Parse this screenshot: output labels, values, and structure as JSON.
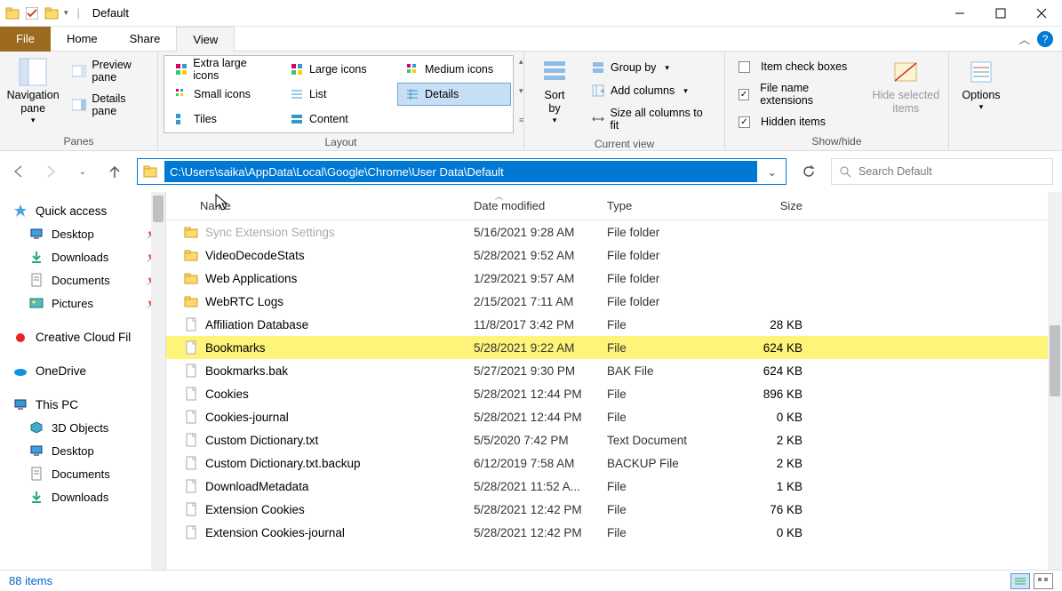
{
  "window": {
    "title": "Default"
  },
  "tabs": {
    "file": "File",
    "home": "Home",
    "share": "Share",
    "view": "View"
  },
  "ribbon": {
    "panes": {
      "label": "Panes",
      "navigation": "Navigation\npane",
      "preview": "Preview pane",
      "details": "Details pane"
    },
    "layout": {
      "label": "Layout",
      "xl_icons": "Extra large icons",
      "lg_icons": "Large icons",
      "md_icons": "Medium icons",
      "sm_icons": "Small icons",
      "list": "List",
      "details": "Details",
      "tiles": "Tiles",
      "content": "Content"
    },
    "currentview": {
      "label": "Current view",
      "sort": "Sort\nby",
      "group": "Group by",
      "addcols": "Add columns",
      "sizecols": "Size all columns to fit"
    },
    "showhide": {
      "label": "Show/hide",
      "itemcheck": "Item check boxes",
      "ext": "File name extensions",
      "hidden": "Hidden items",
      "hidesel": "Hide selected\nitems"
    },
    "options": {
      "label": "Options"
    }
  },
  "address": {
    "path": "C:\\Users\\saika\\AppData\\Local\\Google\\Chrome\\User Data\\Default"
  },
  "search": {
    "placeholder": "Search Default"
  },
  "sidebar": {
    "quick": "Quick access",
    "items": [
      {
        "label": "Desktop",
        "icon": "desktop"
      },
      {
        "label": "Downloads",
        "icon": "download"
      },
      {
        "label": "Documents",
        "icon": "document"
      },
      {
        "label": "Pictures",
        "icon": "picture"
      }
    ],
    "cc": "Creative Cloud Fil",
    "onedrive": "OneDrive",
    "thispc": "This PC",
    "pcitems": [
      {
        "label": "3D Objects",
        "icon": "cube"
      },
      {
        "label": "Desktop",
        "icon": "desktop"
      },
      {
        "label": "Documents",
        "icon": "document"
      },
      {
        "label": "Downloads",
        "icon": "download"
      }
    ]
  },
  "columns": {
    "name": "Name",
    "date": "Date modified",
    "type": "Type",
    "size": "Size"
  },
  "rows": [
    {
      "name": "Sync Extension Settings",
      "date": "5/16/2021 9:28 AM",
      "type": "File folder",
      "size": "",
      "icon": "folder",
      "dim": true
    },
    {
      "name": "VideoDecodeStats",
      "date": "5/28/2021 9:52 AM",
      "type": "File folder",
      "size": "",
      "icon": "folder"
    },
    {
      "name": "Web Applications",
      "date": "1/29/2021 9:57 AM",
      "type": "File folder",
      "size": "",
      "icon": "folder"
    },
    {
      "name": "WebRTC Logs",
      "date": "2/15/2021 7:11 AM",
      "type": "File folder",
      "size": "",
      "icon": "folder"
    },
    {
      "name": "Affiliation Database",
      "date": "11/8/2017 3:42 PM",
      "type": "File",
      "size": "28 KB",
      "icon": "file"
    },
    {
      "name": "Bookmarks",
      "date": "5/28/2021 9:22 AM",
      "type": "File",
      "size": "624 KB",
      "icon": "file",
      "highlight": true
    },
    {
      "name": "Bookmarks.bak",
      "date": "5/27/2021 9:30 PM",
      "type": "BAK File",
      "size": "624 KB",
      "icon": "file"
    },
    {
      "name": "Cookies",
      "date": "5/28/2021 12:44 PM",
      "type": "File",
      "size": "896 KB",
      "icon": "file"
    },
    {
      "name": "Cookies-journal",
      "date": "5/28/2021 12:44 PM",
      "type": "File",
      "size": "0 KB",
      "icon": "file"
    },
    {
      "name": "Custom Dictionary.txt",
      "date": "5/5/2020 7:42 PM",
      "type": "Text Document",
      "size": "2 KB",
      "icon": "file"
    },
    {
      "name": "Custom Dictionary.txt.backup",
      "date": "6/12/2019 7:58 AM",
      "type": "BACKUP File",
      "size": "2 KB",
      "icon": "file"
    },
    {
      "name": "DownloadMetadata",
      "date": "5/28/2021 11:52 A...",
      "type": "File",
      "size": "1 KB",
      "icon": "file"
    },
    {
      "name": "Extension Cookies",
      "date": "5/28/2021 12:42 PM",
      "type": "File",
      "size": "76 KB",
      "icon": "file"
    },
    {
      "name": "Extension Cookies-journal",
      "date": "5/28/2021 12:42 PM",
      "type": "File",
      "size": "0 KB",
      "icon": "file"
    }
  ],
  "status": {
    "count": "88 items"
  }
}
